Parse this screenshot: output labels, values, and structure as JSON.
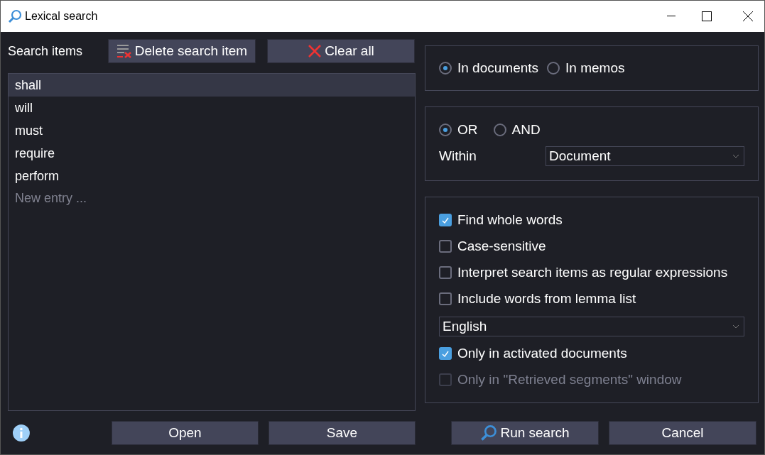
{
  "window": {
    "title": "Lexical search"
  },
  "search_items": {
    "label": "Search items",
    "buttons": [
      {
        "kind": "delete",
        "label": "Delete search item"
      },
      {
        "kind": "clear",
        "label": "Clear all"
      }
    ],
    "items": [
      {
        "text": "shall",
        "selected": true
      },
      {
        "text": "will",
        "selected": false
      },
      {
        "text": "must",
        "selected": false
      },
      {
        "text": "require",
        "selected": false
      },
      {
        "text": "perform",
        "selected": false
      }
    ],
    "placeholder": "New entry ..."
  },
  "footer_left": {
    "buttons": [
      "Open",
      "Save"
    ]
  },
  "scope": [
    {
      "label": "In documents",
      "selected": true
    },
    {
      "label": "In memos",
      "selected": false
    }
  ],
  "logic": [
    {
      "label": "OR",
      "selected": true
    },
    {
      "label": "AND",
      "selected": false
    }
  ],
  "within": {
    "label": "Within",
    "value": "Document"
  },
  "options": [
    {
      "kind": "checkbox",
      "label": "Find whole words",
      "checked": true,
      "disabled": false
    },
    {
      "kind": "checkbox",
      "label": "Case-sensitive",
      "checked": false,
      "disabled": false
    },
    {
      "kind": "checkbox",
      "label": "Interpret search items as regular expressions",
      "checked": false,
      "disabled": false
    },
    {
      "kind": "checkbox",
      "label": "Include words from lemma list",
      "checked": false,
      "disabled": false
    },
    {
      "kind": "select",
      "value": "English"
    },
    {
      "kind": "checkbox",
      "label": "Only in activated documents",
      "checked": true,
      "disabled": false
    },
    {
      "kind": "checkbox",
      "label": "Only in \"Retrieved segments\" window",
      "checked": false,
      "disabled": true
    }
  ],
  "footer_right": {
    "buttons": [
      {
        "kind": "run",
        "label": "Run search"
      },
      {
        "kind": "cancel",
        "label": "Cancel"
      }
    ]
  }
}
